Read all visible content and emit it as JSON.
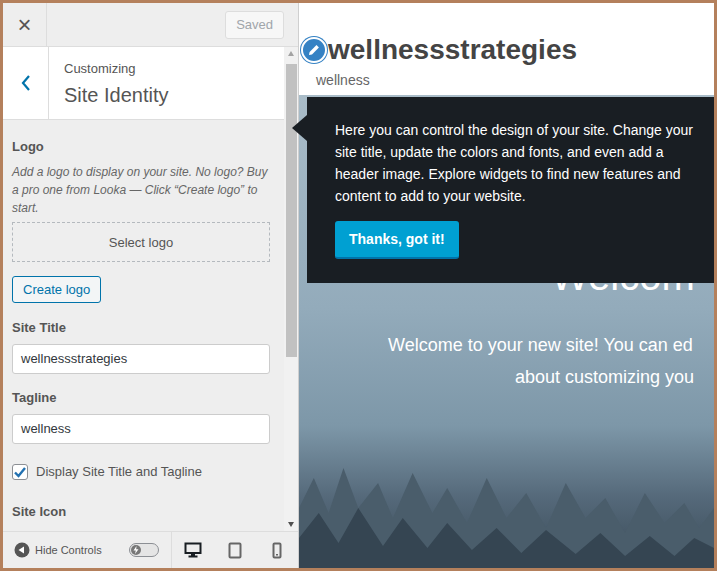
{
  "topbar": {
    "close": "×",
    "save_button": {
      "label": "Saved",
      "disabled": true
    }
  },
  "header": {
    "subtitle": "Customizing",
    "title": "Site Identity"
  },
  "logo": {
    "label": "Logo",
    "description": "Add a logo to display on your site. No logo? Buy a pro one from Looka — Click “Create logo” to start.",
    "select_button": "Select logo",
    "create_button": "Create logo"
  },
  "fields": [
    {
      "label": "Site Title",
      "value": "wellnessstrategies"
    },
    {
      "label": "Tagline",
      "value": "wellness"
    }
  ],
  "display_title_tagline": {
    "label": "Display Site Title and Tagline",
    "checked": true
  },
  "site_icon": {
    "label": "Site Icon"
  },
  "footer": {
    "hide_controls": "Hide Controls",
    "toggle_on": false,
    "devices": [
      {
        "kind": "desktop",
        "selected": true
      },
      {
        "kind": "tablet",
        "selected": false
      },
      {
        "kind": "mobile",
        "selected": false
      }
    ]
  },
  "preview": {
    "site_title": "wellnessstrategies",
    "tagline": "wellness",
    "hero_heading": "Welcom",
    "hero_lines": [
      "Welcome to your new site! You can ed",
      "about customizing you"
    ]
  },
  "tooltip": {
    "text": "Here you can control the design of your site. Change your site title, update the colors and fonts, and even add a header image. Explore widgets to find new features and content to add to your website.",
    "button": "Thanks, got it!"
  }
}
